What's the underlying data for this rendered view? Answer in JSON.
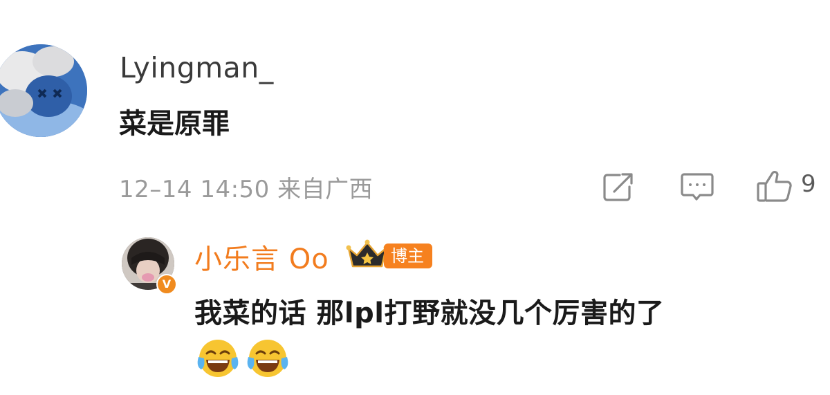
{
  "comment": {
    "username": "Lyingman_",
    "text": "菜是原罪",
    "timestamp": "12–14 14:50",
    "location": "来自广西",
    "like_count": "9",
    "avatar_icon": "kaws-figure-avatar"
  },
  "reply": {
    "username": "小乐言 Oo",
    "badge_label": "博主",
    "badge_icon": "crown-icon",
    "verified_icon": "verified-v-icon",
    "verified_mark": "V",
    "text": "我菜的话 那lpl打野就没几个厉害的了",
    "emojis": [
      "laughing-tears-emoji",
      "laughing-tears-emoji"
    ]
  },
  "colors": {
    "accent": "#f27c1e",
    "badge_bg": "#f6811f",
    "meta_text": "#9a9a9a",
    "icon_stroke": "#8a8a8a"
  }
}
